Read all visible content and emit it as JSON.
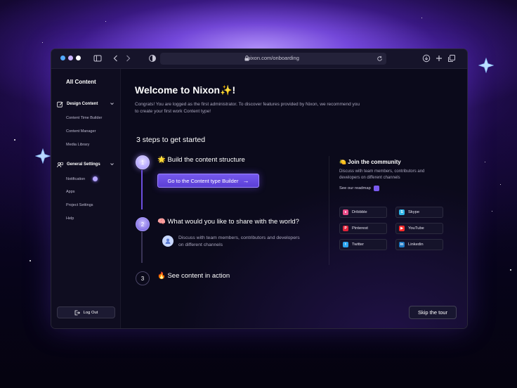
{
  "browser": {
    "url": "nixon.com/onboarding",
    "traffic_lights": [
      "#53a8ff",
      "#c9b2ff",
      "#ffffff"
    ]
  },
  "sidebar": {
    "title": "All Content",
    "sections": [
      {
        "label": "Design Content",
        "icon": "edit-icon",
        "items": [
          "Content Time Builder",
          "Content Manager",
          "Media Library"
        ]
      },
      {
        "label": "General Settings",
        "icon": "users-icon",
        "items": [
          "Notification",
          "Apps",
          "Project Settings",
          "Help"
        ]
      }
    ],
    "logout_label": "Log Out"
  },
  "main": {
    "welcome_title": "Welcome to Nixon✨!",
    "intro_text": "Congrats! You are logged as the first administrator. To discover features provided by Nixon, we recommend you to create your first work Content type!",
    "steps_title": "3 steps to get started",
    "steps": [
      {
        "number": "1",
        "title": "🌟 Build the content structure",
        "button_label": "Go to the Content type Builder",
        "button_arrow": "→"
      },
      {
        "number": "2",
        "title": "🧠 What would you like to share with the world?",
        "description": "Discuss with team members, contributors and developers on different channels"
      },
      {
        "number": "3",
        "title": "🔥 See content in action"
      }
    ],
    "community": {
      "title": "🍋 Join the community",
      "description": "Discuss with team members, contributors and developers on different channels",
      "roadmap_label": "See our readmap",
      "links": [
        {
          "label": "Dribbble",
          "icon": "dribbble-icon",
          "color": "#ea4c89"
        },
        {
          "label": "Skype",
          "icon": "skype-icon",
          "color": "#2fb6e8"
        },
        {
          "label": "Pinterest",
          "icon": "pinterest-icon",
          "color": "#e0233a"
        },
        {
          "label": "YouTube",
          "icon": "youtube-icon",
          "color": "#ff2b2b"
        },
        {
          "label": "Twitter",
          "icon": "twitter-icon",
          "color": "#2aa3ef"
        },
        {
          "label": "Linkedin",
          "icon": "linkedin-icon",
          "color": "#1f7ac4"
        }
      ]
    },
    "skip_label": "Skip the tour"
  },
  "colors": {
    "accent": "#6a4de6",
    "background": "#0b0a1b"
  }
}
